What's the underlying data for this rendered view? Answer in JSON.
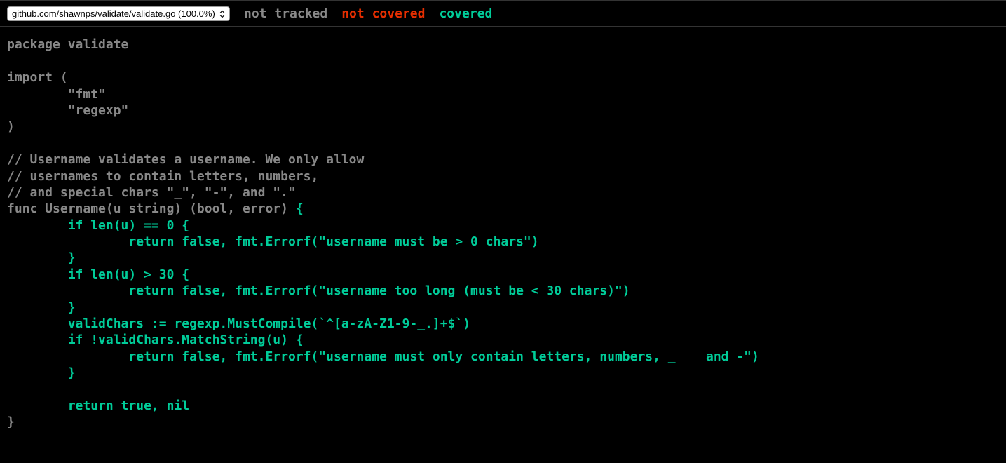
{
  "toolbar": {
    "file_select_value": "github.com/shawnps/validate/validate.go (100.0%)",
    "legend_not_tracked": "not tracked",
    "legend_not_covered": "not covered",
    "legend_covered": "covered"
  },
  "code": {
    "l1": "package validate",
    "l2": "",
    "l3": "import (",
    "l4": "        \"fmt\"",
    "l5": "        \"regexp\"",
    "l6": ")",
    "l7": "",
    "l8": "// Username validates a username. We only allow",
    "l9": "// usernames to contain letters, numbers,",
    "l10": "// and special chars \"_\", \"-\", and \".\"",
    "l11a": "func Username(u string) (bool, error) ",
    "l11b": "{",
    "l12": "        if len(u) == 0 {",
    "l13": "                return false, fmt.Errorf(\"username must be > 0 chars\")",
    "l14": "        }",
    "l15": "        if len(u) > 30 {",
    "l16": "                return false, fmt.Errorf(\"username too long (must be < 30 chars)\")",
    "l17": "        }",
    "l18": "        validChars := regexp.MustCompile(`^[a-zA-Z1-9-_.]+$`)",
    "l19": "        if !validChars.MatchString(u) {",
    "l20": "                return false, fmt.Errorf(\"username must only contain letters, numbers, _    and -\")",
    "l21": "        }",
    "l22": "",
    "l23": "        return true, nil",
    "l24": "}"
  }
}
